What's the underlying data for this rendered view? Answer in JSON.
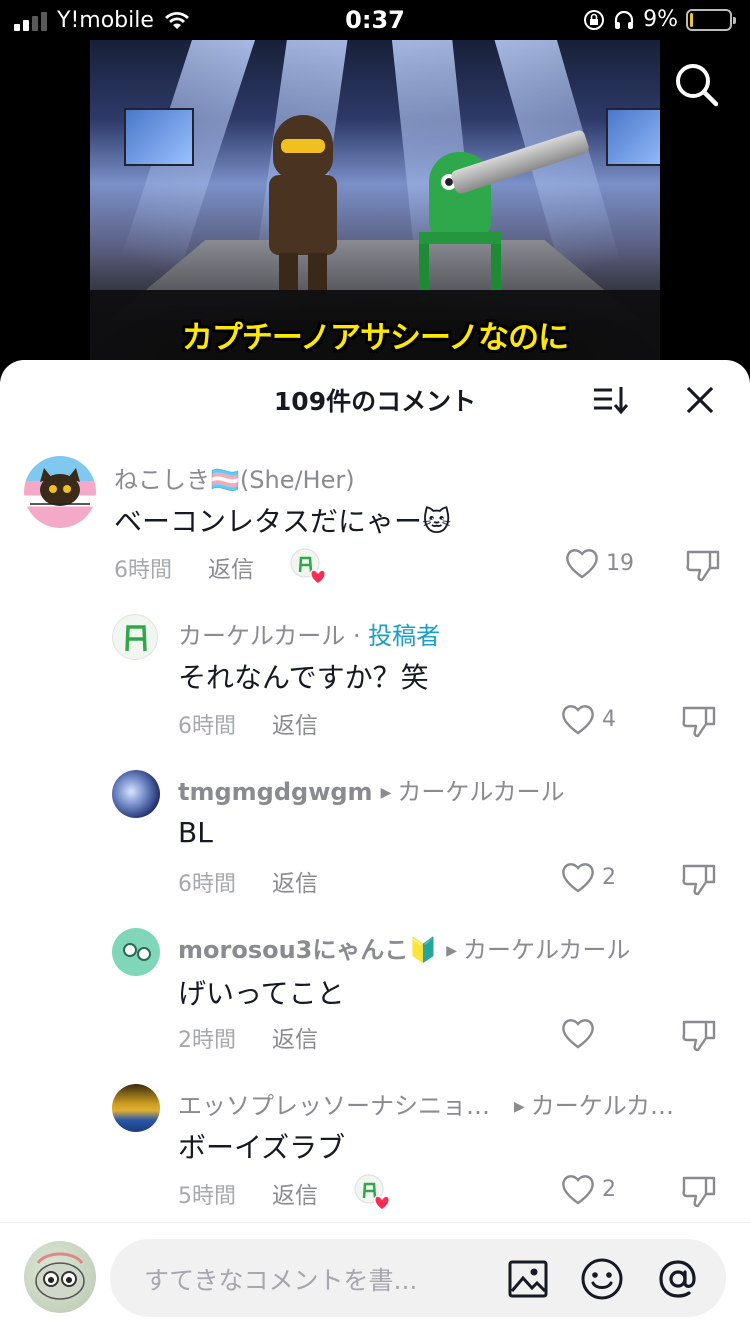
{
  "status_bar": {
    "carrier": "Y!mobile",
    "time": "0:37",
    "battery": "9%",
    "battery_level": 0.09
  },
  "video": {
    "caption": "カプチーノアサシーノなのに"
  },
  "comments_header": {
    "title": "109件のコメント"
  },
  "comments": [
    {
      "author": "ねこしき🏳️‍⚧️(She/Her)",
      "text": "ベーコンレタスだにゃー🐱",
      "time": "6時間",
      "reply_label": "返信",
      "likes": "19",
      "creator_liked": true
    },
    {
      "author": "カーケルカール",
      "author_sep": " · ",
      "creator_tag": "投稿者",
      "text": "それなんですか？笑",
      "time": "6時間",
      "reply_label": "返信",
      "likes": "4"
    },
    {
      "author": "tmgmgdgwgm",
      "reply_to": "カーケルカール",
      "text": "BL",
      "time": "6時間",
      "reply_label": "返信",
      "likes": "2"
    },
    {
      "author": "morosou3にゃんこ🔰",
      "reply_to": "カーケルカール",
      "text": "げいってこと",
      "time": "2時間",
      "reply_label": "返信",
      "likes": ""
    },
    {
      "author": "エッソプレッソーナシニョ…",
      "reply_to": "カーケルカ…",
      "text": "ボーイズラブ",
      "time": "5時間",
      "reply_label": "返信",
      "likes": "2",
      "creator_liked": true
    }
  ],
  "input": {
    "placeholder": "すてきなコメントを書..."
  },
  "icons": {
    "search": "search-icon",
    "sort": "sort-icon",
    "close": "close-icon",
    "like": "heart-icon",
    "dislike": "dislike-icon",
    "image": "image-icon",
    "emoji": "emoji-icon",
    "mention": "at-icon"
  },
  "colors": {
    "creator_tag": "#1aa0c8",
    "liked_heart": "#fe2c55",
    "caption": "#ffe800"
  }
}
